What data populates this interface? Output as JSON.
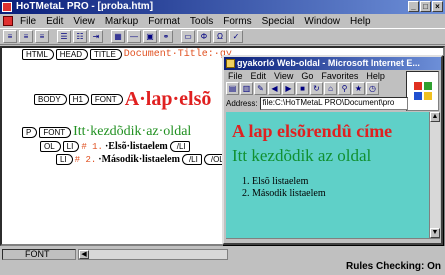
{
  "app": {
    "title": "HoTMetaL PRO - [proba.htm]",
    "menu": [
      "File",
      "Edit",
      "View",
      "Markup",
      "Format",
      "Tools",
      "Forms",
      "Special",
      "Window",
      "Help"
    ]
  },
  "editor": {
    "tags": {
      "html": "HTML",
      "head": "HEAD",
      "title": "TITLE",
      "body": "BODY",
      "h1": "H1",
      "font": "FONT",
      "p": "P",
      "font2": "FONT",
      "ol": "OL",
      "li": "LI",
      "li_close": "/LI",
      "ol_close": "/OL"
    },
    "title_text": "Document·Title:·gy",
    "h1_text": "A·lap·elsõ",
    "h2_text": "Itt·kezdõdik·az·oldal",
    "li1_marker": "# 1.",
    "li1_text": "·Elsõ·listaelem",
    "li2_marker": "# 2.",
    "li2_text": "·Második·listaelem"
  },
  "status": {
    "element": "FONT",
    "rules": "Rules Checking: On"
  },
  "browser": {
    "title": "gyakorló Web-oldal - Microsoft Internet E...",
    "menu": [
      "File",
      "Edit",
      "View",
      "Go",
      "Favorites",
      "Help"
    ],
    "address_label": "Address:",
    "address": "file:C:\\HoTMetaL PRO\\Document\\pro",
    "heading": "A lap elsõrendû címe",
    "subheading": "Itt kezdõdik az oldal",
    "list": [
      "Elsõ listaelem",
      "Második listaelem"
    ]
  },
  "colors": {
    "heading_red": "#e02020",
    "subheading_green": "#109030",
    "browser_bg": "#5fd0c8",
    "titlebar": "#0a1f7a"
  }
}
